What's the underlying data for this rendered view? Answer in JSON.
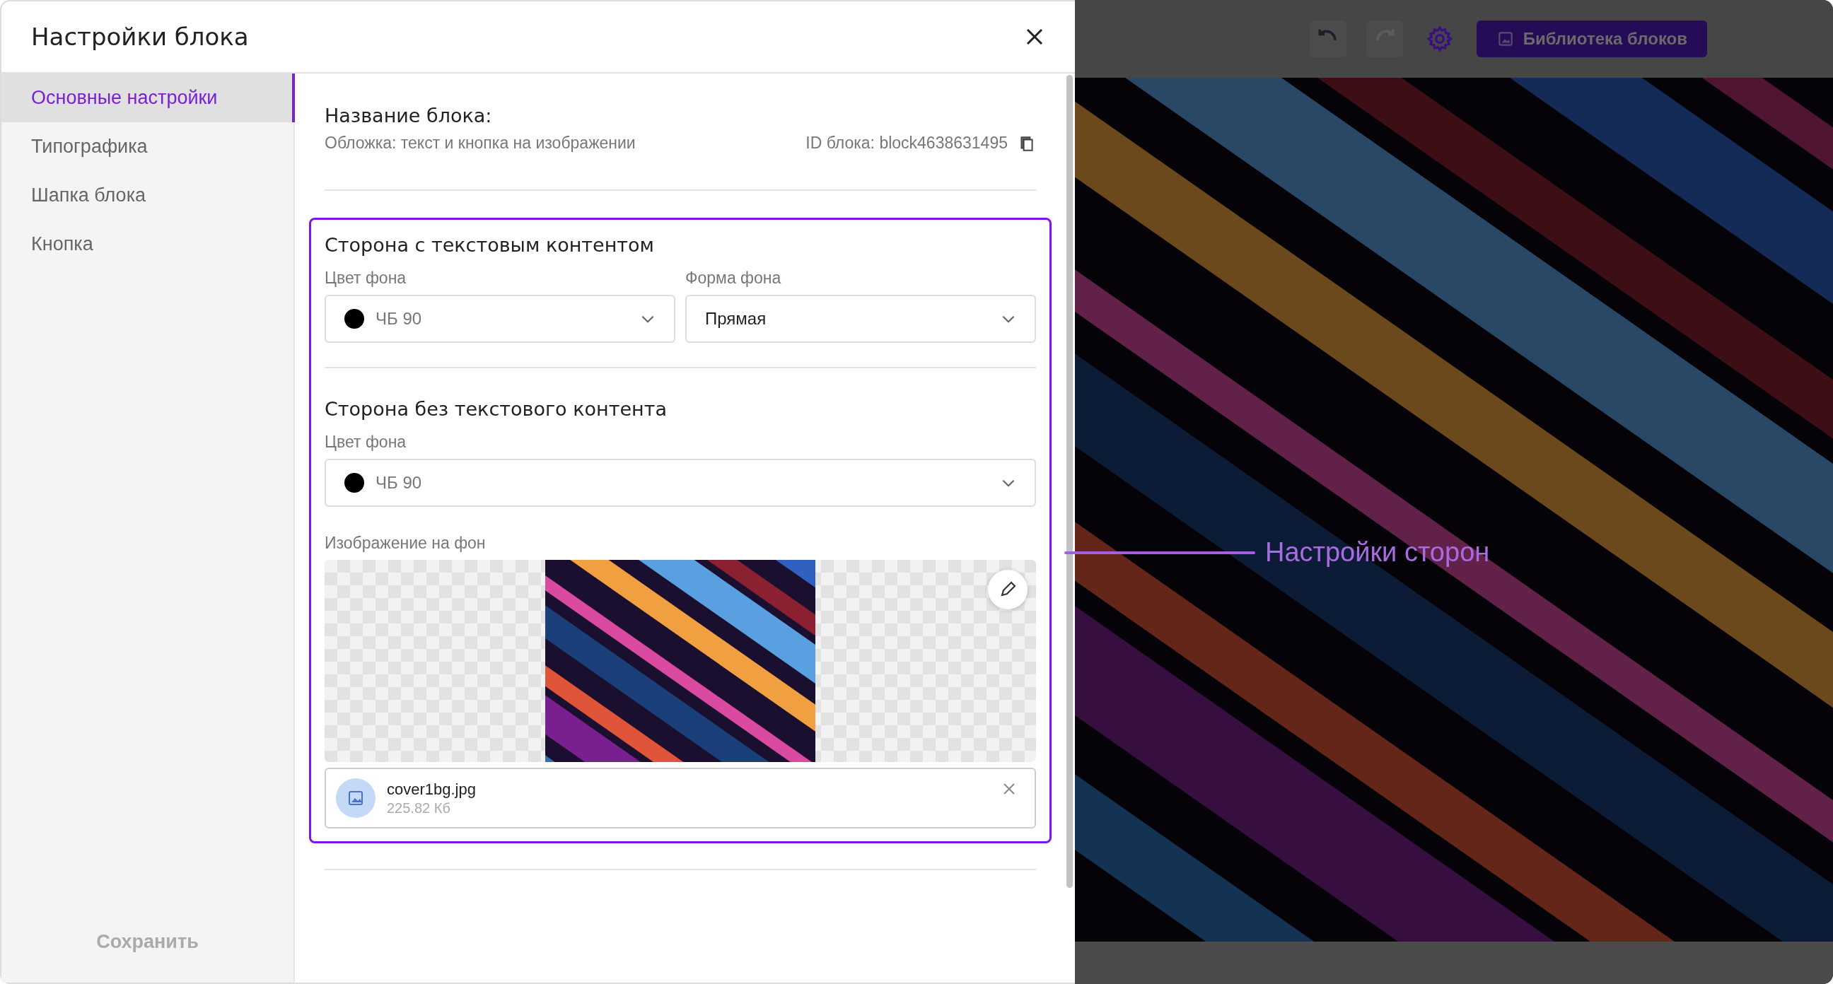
{
  "dialog": {
    "title": "Настройки блока"
  },
  "sidebar": {
    "items": [
      {
        "label": "Основные настройки",
        "selected": true
      },
      {
        "label": "Типографика",
        "selected": false
      },
      {
        "label": "Шапка блока",
        "selected": false
      },
      {
        "label": "Кнопка",
        "selected": false
      }
    ],
    "save_button": "Сохранить"
  },
  "block_info": {
    "name_label": "Название блока:",
    "name": "Обложка: текст и кнопка на изображении",
    "id": "ID блока: block4638631495"
  },
  "sections": [
    {
      "title": "Сторона с текстовым контентом",
      "fields": [
        {
          "kind": "color",
          "label": "Цвет фона",
          "value": "ЧБ 90"
        },
        {
          "kind": "select",
          "label": "Форма фона",
          "value": "Прямая"
        }
      ]
    },
    {
      "title": "Сторона без текстового контента",
      "fields": [
        {
          "kind": "color",
          "label": "Цвет фона",
          "value": "ЧБ 90"
        }
      ],
      "image": {
        "label": "Изображение на фон",
        "file_name": "cover1bg.jpg",
        "file_size": "225.82 Кб"
      }
    }
  ],
  "toolbar": {
    "undo": {
      "disabled": false
    },
    "redo": {
      "disabled": true
    },
    "library_button": "Библиотека блоков"
  },
  "annotation": "Настройки сторон"
}
